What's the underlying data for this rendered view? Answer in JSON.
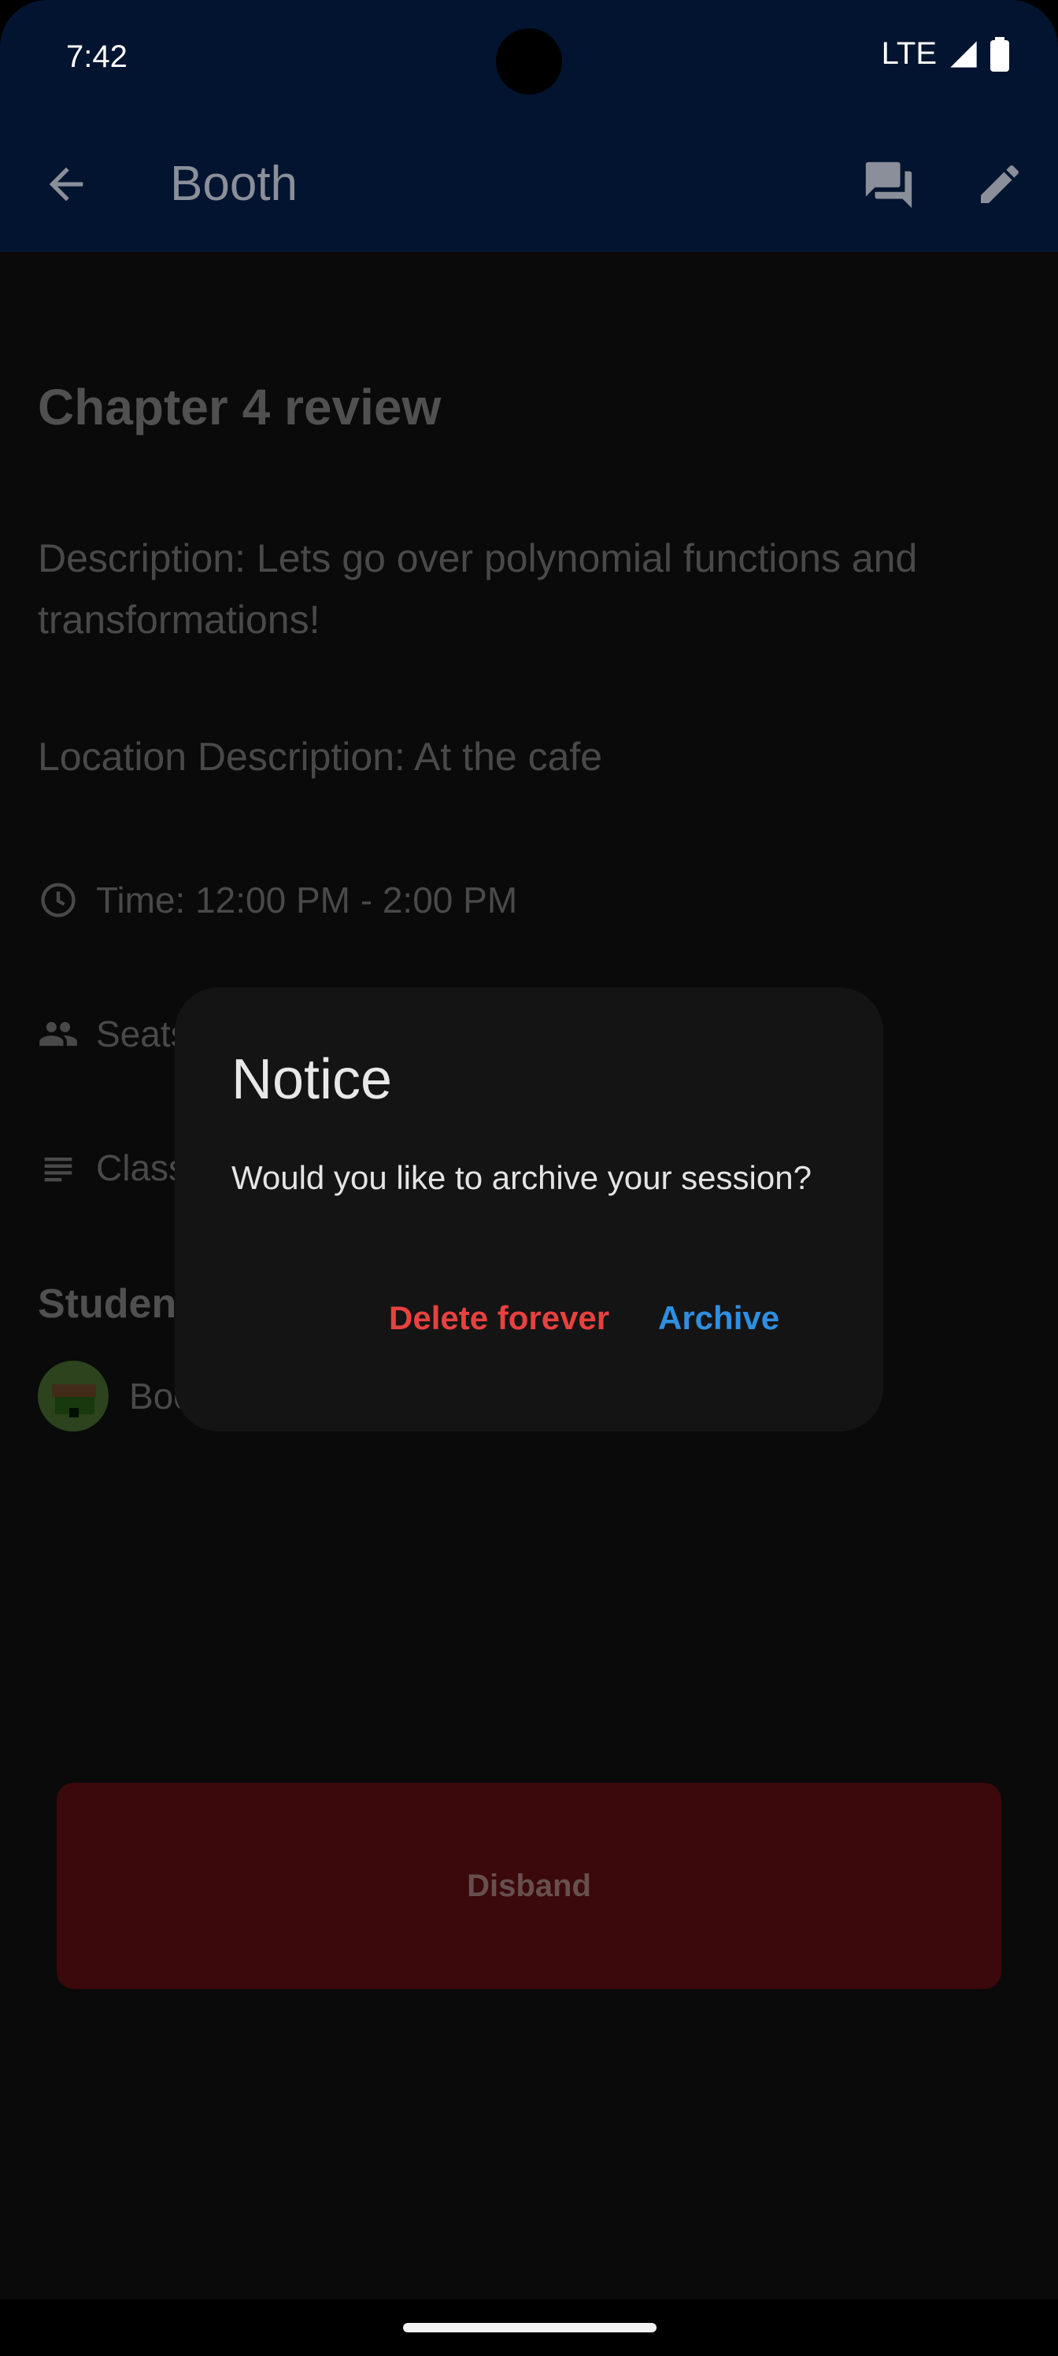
{
  "status_bar": {
    "time": "7:42",
    "network": "LTE"
  },
  "app_bar": {
    "title": "Booth"
  },
  "session": {
    "title": "Chapter 4 review",
    "description": "Description: Lets go over polynomial functions and transformations!",
    "location": "Location Description: At the cafe",
    "time": "Time: 12:00 PM - 2:00 PM",
    "seats_partial": "Seats",
    "class_partial": "Class",
    "students_heading_partial": "Studen",
    "student_name_partial": "Boo"
  },
  "dialog": {
    "title": "Notice",
    "body": "Would you like to archive your session?",
    "delete_label": "Delete forever",
    "archive_label": "Archive"
  },
  "actions": {
    "disband_label": "Disband"
  },
  "colors": {
    "app_bar": "#02142f",
    "delete": "#e8413f",
    "archive": "#2f8fe0",
    "disband_bg": "#4f0d0f"
  }
}
